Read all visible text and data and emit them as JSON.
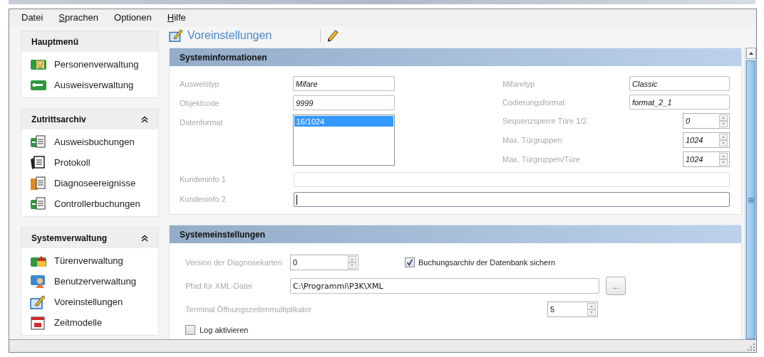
{
  "menu": [
    {
      "label": "Datei",
      "mnemonic": false
    },
    {
      "label": "Sprachen",
      "mnemonic": true
    },
    {
      "label": "Optionen",
      "mnemonic": false
    },
    {
      "label": "Hilfe",
      "mnemonic": true
    }
  ],
  "sidebar": {
    "groups": [
      {
        "title": "Hauptmenü",
        "kind": "fixed",
        "items": [
          {
            "label": "Personenverwaltung"
          },
          {
            "label": "Ausweisverwaltung"
          }
        ]
      },
      {
        "title": "Zutrittsarchiv",
        "kind": "collapsible",
        "expanded": true,
        "items": [
          {
            "label": "Ausweisbuchungen"
          },
          {
            "label": "Protokoll"
          },
          {
            "label": "Diagnoseereignisse"
          },
          {
            "label": "Controllerbuchungen"
          }
        ]
      },
      {
        "title": "Systemverwaltung",
        "kind": "collapsible",
        "expanded": true,
        "items": [
          {
            "label": "Türenverwaltung"
          },
          {
            "label": "Benutzerverwaltung"
          },
          {
            "label": "Voreinstellungen"
          },
          {
            "label": "Zeitmodelle"
          }
        ]
      }
    ]
  },
  "header": {
    "title": "Voreinstellungen"
  },
  "systeminformationen": {
    "title": "Systeminformationen",
    "left": [
      {
        "kind": "text",
        "label": "Ausweistyp",
        "value": "Mifare"
      },
      {
        "kind": "text",
        "label": "Objektcode",
        "value": "9999"
      },
      {
        "kind": "list",
        "label": "Datenformat",
        "options": [
          {
            "label": "16/1024",
            "selected": true
          }
        ]
      }
    ],
    "right": [
      {
        "kind": "text",
        "label": "Mifaretyp",
        "value": "Classic"
      },
      {
        "kind": "text",
        "label": "Codierungsformat",
        "value": "format_2_1"
      },
      {
        "kind": "spinner",
        "label": "Sequenzsperre Türe 1/2",
        "value": "0"
      },
      {
        "kind": "spinner",
        "label": "Max. Türgruppen",
        "value": "1024"
      },
      {
        "kind": "spinner",
        "label": "Max. Türgruppen/Türe",
        "value": "1024"
      }
    ],
    "wide": [
      {
        "label": "Kundeninfo 1",
        "focused": false
      },
      {
        "label": "Kundeninfo 2",
        "focused": true
      }
    ]
  },
  "systemeinstellungen": {
    "title": "Systemeinstellungen",
    "version": {
      "label": "Version der Diagnosekarten",
      "value": "0"
    },
    "archive": {
      "label": "Buchungsarchiv der Datenbank sichern",
      "checked": true
    },
    "xml_path": {
      "label": "Pfad für XML-Datei",
      "value": "C:\\Programmi\\P3K\\XML",
      "button": "..."
    },
    "multiplier": {
      "label": "Terminal Öffnungszeitenmultiplikator",
      "value": "5"
    },
    "log": {
      "label": "Log aktivieren",
      "checked": false
    }
  }
}
